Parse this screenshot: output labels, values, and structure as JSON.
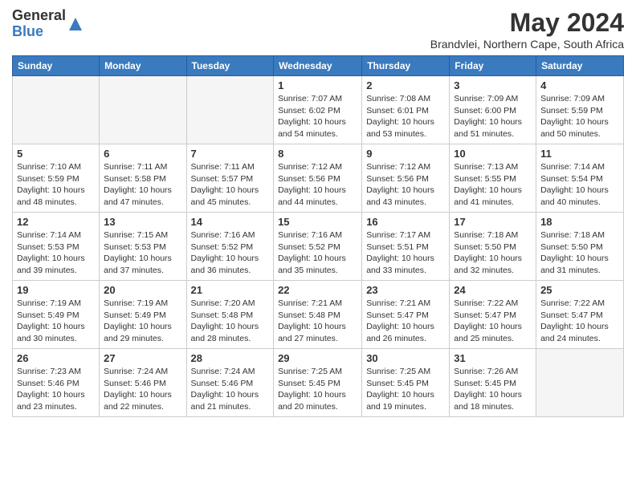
{
  "header": {
    "logo_general": "General",
    "logo_blue": "Blue",
    "month_title": "May 2024",
    "location": "Brandvlei, Northern Cape, South Africa"
  },
  "days_of_week": [
    "Sunday",
    "Monday",
    "Tuesday",
    "Wednesday",
    "Thursday",
    "Friday",
    "Saturday"
  ],
  "weeks": [
    [
      {
        "day": "",
        "empty": true
      },
      {
        "day": "",
        "empty": true
      },
      {
        "day": "",
        "empty": true
      },
      {
        "day": "1",
        "sunrise": "7:07 AM",
        "sunset": "6:02 PM",
        "daylight": "10 hours and 54 minutes."
      },
      {
        "day": "2",
        "sunrise": "7:08 AM",
        "sunset": "6:01 PM",
        "daylight": "10 hours and 53 minutes."
      },
      {
        "day": "3",
        "sunrise": "7:09 AM",
        "sunset": "6:00 PM",
        "daylight": "10 hours and 51 minutes."
      },
      {
        "day": "4",
        "sunrise": "7:09 AM",
        "sunset": "5:59 PM",
        "daylight": "10 hours and 50 minutes."
      }
    ],
    [
      {
        "day": "5",
        "sunrise": "7:10 AM",
        "sunset": "5:59 PM",
        "daylight": "10 hours and 48 minutes."
      },
      {
        "day": "6",
        "sunrise": "7:11 AM",
        "sunset": "5:58 PM",
        "daylight": "10 hours and 47 minutes."
      },
      {
        "day": "7",
        "sunrise": "7:11 AM",
        "sunset": "5:57 PM",
        "daylight": "10 hours and 45 minutes."
      },
      {
        "day": "8",
        "sunrise": "7:12 AM",
        "sunset": "5:56 PM",
        "daylight": "10 hours and 44 minutes."
      },
      {
        "day": "9",
        "sunrise": "7:12 AM",
        "sunset": "5:56 PM",
        "daylight": "10 hours and 43 minutes."
      },
      {
        "day": "10",
        "sunrise": "7:13 AM",
        "sunset": "5:55 PM",
        "daylight": "10 hours and 41 minutes."
      },
      {
        "day": "11",
        "sunrise": "7:14 AM",
        "sunset": "5:54 PM",
        "daylight": "10 hours and 40 minutes."
      }
    ],
    [
      {
        "day": "12",
        "sunrise": "7:14 AM",
        "sunset": "5:53 PM",
        "daylight": "10 hours and 39 minutes."
      },
      {
        "day": "13",
        "sunrise": "7:15 AM",
        "sunset": "5:53 PM",
        "daylight": "10 hours and 37 minutes."
      },
      {
        "day": "14",
        "sunrise": "7:16 AM",
        "sunset": "5:52 PM",
        "daylight": "10 hours and 36 minutes."
      },
      {
        "day": "15",
        "sunrise": "7:16 AM",
        "sunset": "5:52 PM",
        "daylight": "10 hours and 35 minutes."
      },
      {
        "day": "16",
        "sunrise": "7:17 AM",
        "sunset": "5:51 PM",
        "daylight": "10 hours and 33 minutes."
      },
      {
        "day": "17",
        "sunrise": "7:18 AM",
        "sunset": "5:50 PM",
        "daylight": "10 hours and 32 minutes."
      },
      {
        "day": "18",
        "sunrise": "7:18 AM",
        "sunset": "5:50 PM",
        "daylight": "10 hours and 31 minutes."
      }
    ],
    [
      {
        "day": "19",
        "sunrise": "7:19 AM",
        "sunset": "5:49 PM",
        "daylight": "10 hours and 30 minutes."
      },
      {
        "day": "20",
        "sunrise": "7:19 AM",
        "sunset": "5:49 PM",
        "daylight": "10 hours and 29 minutes."
      },
      {
        "day": "21",
        "sunrise": "7:20 AM",
        "sunset": "5:48 PM",
        "daylight": "10 hours and 28 minutes."
      },
      {
        "day": "22",
        "sunrise": "7:21 AM",
        "sunset": "5:48 PM",
        "daylight": "10 hours and 27 minutes."
      },
      {
        "day": "23",
        "sunrise": "7:21 AM",
        "sunset": "5:47 PM",
        "daylight": "10 hours and 26 minutes."
      },
      {
        "day": "24",
        "sunrise": "7:22 AM",
        "sunset": "5:47 PM",
        "daylight": "10 hours and 25 minutes."
      },
      {
        "day": "25",
        "sunrise": "7:22 AM",
        "sunset": "5:47 PM",
        "daylight": "10 hours and 24 minutes."
      }
    ],
    [
      {
        "day": "26",
        "sunrise": "7:23 AM",
        "sunset": "5:46 PM",
        "daylight": "10 hours and 23 minutes."
      },
      {
        "day": "27",
        "sunrise": "7:24 AM",
        "sunset": "5:46 PM",
        "daylight": "10 hours and 22 minutes."
      },
      {
        "day": "28",
        "sunrise": "7:24 AM",
        "sunset": "5:46 PM",
        "daylight": "10 hours and 21 minutes."
      },
      {
        "day": "29",
        "sunrise": "7:25 AM",
        "sunset": "5:45 PM",
        "daylight": "10 hours and 20 minutes."
      },
      {
        "day": "30",
        "sunrise": "7:25 AM",
        "sunset": "5:45 PM",
        "daylight": "10 hours and 19 minutes."
      },
      {
        "day": "31",
        "sunrise": "7:26 AM",
        "sunset": "5:45 PM",
        "daylight": "10 hours and 18 minutes."
      },
      {
        "day": "",
        "empty": true
      }
    ]
  ]
}
